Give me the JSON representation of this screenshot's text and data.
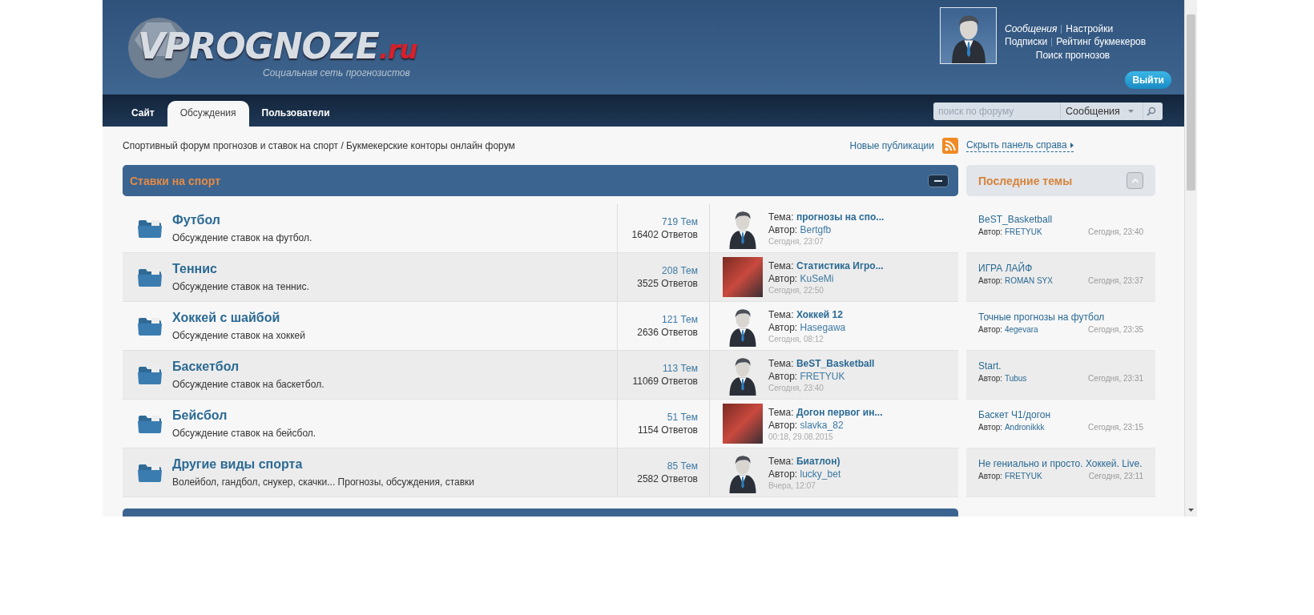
{
  "header": {
    "logo": "VPROGNOZE",
    "logo_suffix": ".ru",
    "tagline": "Социальная сеть прогнозистов",
    "user_links": [
      [
        {
          "label": "Сообщения",
          "emphasized": true
        },
        {
          "label": "Настройки",
          "emphasized": false
        }
      ],
      [
        {
          "label": "Подписки",
          "emphasized": false
        },
        {
          "label": "Рейтинг букмекеров",
          "emphasized": false
        }
      ],
      [
        {
          "label": "Поиск прогнозов",
          "emphasized": false
        }
      ]
    ],
    "logout": "Выйти"
  },
  "nav": {
    "tabs": [
      {
        "label": "Сайт",
        "selected": false
      },
      {
        "label": "Обсуждения",
        "selected": true
      },
      {
        "label": "Пользователи",
        "selected": false
      }
    ],
    "search": {
      "placeholder": "поиск по форуму",
      "scope": "Сообщения"
    }
  },
  "breadcrumb": "Спортивный форум прогнозов и ставок на спорт / Букмекерские конторы онлайн форум",
  "new_posts": "Новые публикации",
  "hide_panel": "Скрыть панель справа",
  "category": {
    "title": "Ставки на спорт"
  },
  "forums": [
    {
      "title": "Футбол",
      "description": "Обсуждение ставок на футбол.",
      "threads": "719 Тем",
      "replies": "16402 Ответов",
      "topic_label": "Тема:",
      "topic": "прогнозы на спо...",
      "author_label": "Автор:",
      "author": "Bertgfb",
      "time": "Сегодня, 23:07",
      "avatar": {
        "kind": "silhouette"
      }
    },
    {
      "title": "Теннис",
      "description": "Обсуждение ставок на теннис.",
      "threads": "208 Тем",
      "replies": "3525 Ответов",
      "topic_label": "Тема:",
      "topic": "Статистика Игро...",
      "author_label": "Автор:",
      "author": "KuSeMi",
      "time": "Сегодня, 22:50",
      "avatar": {
        "kind": "photo"
      }
    },
    {
      "title": "Хоккей с шайбой",
      "description": "Обсуждение ставок на хоккей",
      "threads": "121 Тем",
      "replies": "2636 Ответов",
      "topic_label": "Тема:",
      "topic": "Хоккей 12",
      "author_label": "Автор:",
      "author": "Hasegawa",
      "time": "Сегодня, 08:12",
      "avatar": {
        "kind": "silhouette"
      }
    },
    {
      "title": "Баскетбол",
      "description": "Обсуждение ставок на баскетбол.",
      "threads": "113 Тем",
      "replies": "11069 Ответов",
      "topic_label": "Тема:",
      "topic": "BeST_Basketball",
      "author_label": "Автор:",
      "author": "FRETYUK",
      "time": "Сегодня, 23:40",
      "avatar": {
        "kind": "silhouette"
      }
    },
    {
      "title": "Бейсбол",
      "description": "Обсуждение ставок на бейсбол.",
      "threads": "51 Тем",
      "replies": "1154 Ответов",
      "topic_label": "Тема:",
      "topic": "Догон первог ин...",
      "author_label": "Автор:",
      "author": "slavka_82",
      "time": "00:18, 29.08.2015",
      "avatar": {
        "kind": "photo"
      }
    },
    {
      "title": "Другие виды спорта",
      "description": "Волейбол, гандбол, снукер, скачки... Прогнозы, обсуждения, ставки",
      "threads": "85 Тем",
      "replies": "2582 Ответов",
      "topic_label": "Тема:",
      "topic": "Биатлон)",
      "author_label": "Автор:",
      "author": "lucky_bet",
      "time": "Вчера, 12:07",
      "avatar": {
        "kind": "silhouette"
      }
    }
  ],
  "sidebar": {
    "title": "Последние темы",
    "items": [
      {
        "title": "BeST_Basketball",
        "author_label": "Автор:",
        "author": "FRETYUK",
        "time": "Сегодня, 23:40"
      },
      {
        "title": "ИГРА ЛАЙФ",
        "author_label": "Автор:",
        "author": "ROMAN SYX",
        "time": "Сегодня, 23:37"
      },
      {
        "title": "Точные прогнозы на футбол",
        "author_label": "Автор:",
        "author": "4egevara",
        "time": "Сегодня, 23:35"
      },
      {
        "title": "Start.",
        "author_label": "Автор:",
        "author": "Tubus",
        "time": "Сегодня, 23:31"
      },
      {
        "title": "Баскет Ч1/догон",
        "author_label": "Автор:",
        "author": "Andronikkk",
        "time": "Сегодня, 23:15"
      },
      {
        "title": "Не гениально и просто. Хоккей. Live.",
        "author_label": "Автор:",
        "author": "FRETYUK",
        "time": "Сегодня, 23:11"
      }
    ]
  }
}
